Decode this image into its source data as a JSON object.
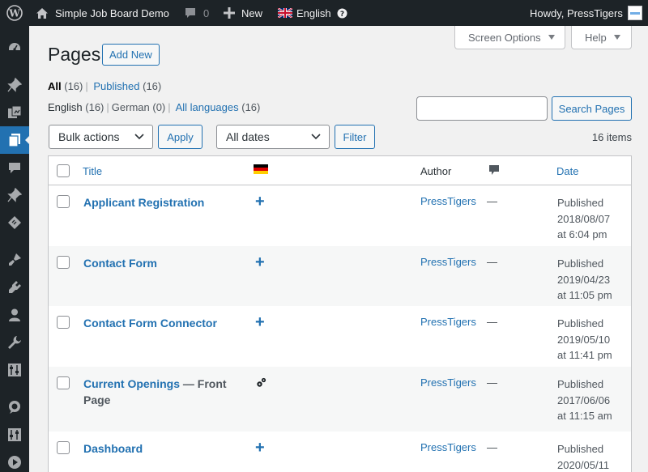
{
  "admin_bar": {
    "site_name": "Simple Job Board Demo",
    "comments_count": "0",
    "new_label": "New",
    "language": "English",
    "howdy": "Howdy, PressTigers"
  },
  "screen_meta": {
    "screen_options": "Screen Options",
    "help": "Help"
  },
  "page": {
    "title": "Pages",
    "add_new": "Add New"
  },
  "status_filters": [
    {
      "label": "All",
      "count": "(16)"
    },
    {
      "label": "Published",
      "count": "(16)"
    }
  ],
  "language_filters": [
    {
      "label": "English",
      "count": "(16)"
    },
    {
      "label": "German",
      "count": "(0)"
    },
    {
      "label": "All languages",
      "count": "(16)"
    }
  ],
  "search": {
    "value": "",
    "button": "Search Pages"
  },
  "bulk": {
    "selected": "Bulk actions",
    "apply": "Apply"
  },
  "dates": {
    "selected": "All dates",
    "filter": "Filter"
  },
  "items_count": "16 items",
  "table": {
    "headers": {
      "title": "Title",
      "author": "Author",
      "date": "Date"
    },
    "rows": [
      {
        "title": "Applicant Registration",
        "state": "",
        "state_cont": "",
        "lang_action": "plus",
        "author": "PressTigers",
        "comments": "—",
        "status": "Published",
        "date": "2018/08/07",
        "time": "at 6:04 pm"
      },
      {
        "title": "Contact Form",
        "state": "",
        "state_cont": "",
        "lang_action": "plus",
        "author": "PressTigers",
        "comments": "—",
        "status": "Published",
        "date": "2019/04/23",
        "time": "at 11:05 pm"
      },
      {
        "title": "Contact Form Connector",
        "state": "",
        "state_cont": "",
        "lang_action": "plus",
        "author": "PressTigers",
        "comments": "—",
        "status": "Published",
        "date": "2019/05/10",
        "time": "at 11:41 pm"
      },
      {
        "title": "Current Openings",
        "state": "— Front",
        "state_cont": "Page",
        "lang_action": "gear",
        "author": "PressTigers",
        "comments": "—",
        "status": "Published",
        "date": "2017/06/06",
        "time": "at 11:15 am"
      },
      {
        "title": "Dashboard",
        "state": "",
        "state_cont": "",
        "lang_action": "plus",
        "author": "PressTigers",
        "comments": "—",
        "status": "Published",
        "date": "2020/05/11",
        "time": ""
      }
    ]
  },
  "colors": {
    "accent": "#2271b1",
    "admin_bar": "#1d2327",
    "background": "#f1f1f1"
  }
}
